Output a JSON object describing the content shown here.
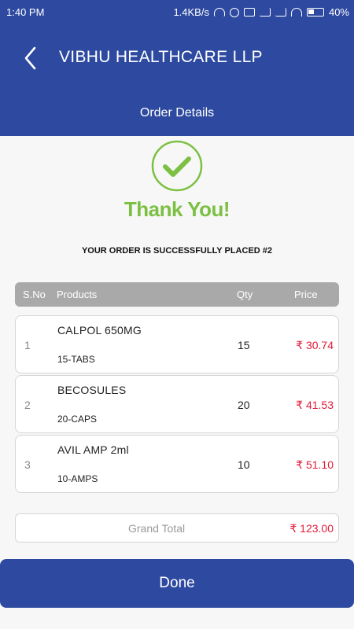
{
  "status_bar": {
    "time": "1:40 PM",
    "speed": "1.4KB/s",
    "battery": "40%",
    "icons": [
      "headphones-icon",
      "alarm-icon",
      "volte-icon",
      "signal-4g-icon",
      "signal-icon",
      "wifi-icon",
      "battery-icon"
    ]
  },
  "header": {
    "title": "VIBHU HEALTHCARE LLP",
    "subtitle": "Order Details",
    "back_icon": "chevron-left-icon"
  },
  "success": {
    "icon": "check-circle-icon",
    "thank_you": "Thank You!",
    "message": "YOUR ORDER IS SUCCESSFULLY PLACED  #2"
  },
  "table": {
    "headers": {
      "sno": "S.No",
      "products": "Products",
      "qty": "Qty",
      "price": "Price"
    },
    "rows": [
      {
        "sno": "1",
        "product": "CALPOL 650MG",
        "pack": "15-TABS",
        "qty": "15",
        "price": "₹ 30.74"
      },
      {
        "sno": "2",
        "product": "BECOSULES",
        "pack": "20-CAPS",
        "qty": "20",
        "price": "₹ 41.53"
      },
      {
        "sno": "3",
        "product": "AVIL AMP 2ml",
        "pack": "10-AMPS",
        "qty": "10",
        "price": "₹ 51.10"
      }
    ]
  },
  "total": {
    "label": "Grand Total",
    "value": "₹ 123.00"
  },
  "done_label": "Done",
  "colors": {
    "primary": "#2e4aa0",
    "success": "#7cc043",
    "price": "#e01a38",
    "header_gray": "#a9a9a9"
  }
}
